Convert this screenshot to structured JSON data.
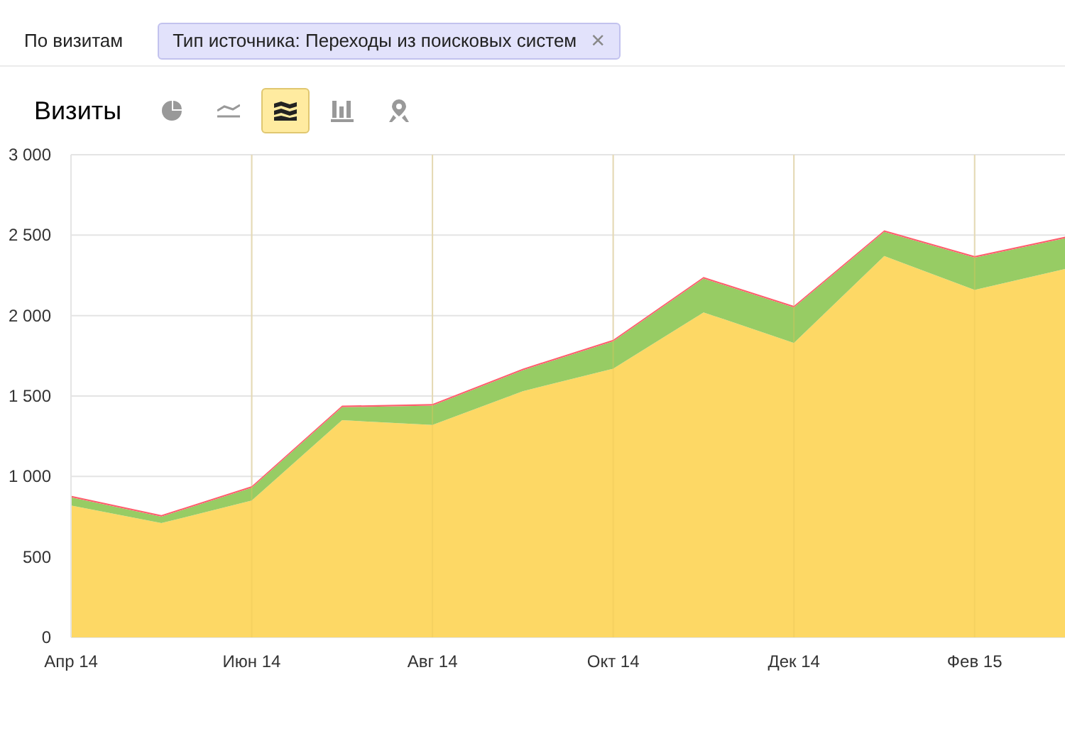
{
  "filter_bar": {
    "label": "По визитам",
    "chip": {
      "text": "Тип источника: Переходы из поисковых систем",
      "close": "×"
    }
  },
  "chart_header": {
    "title": "Визиты",
    "chart_types": [
      {
        "kind": "pie",
        "selected": false
      },
      {
        "kind": "line",
        "selected": false
      },
      {
        "kind": "area",
        "selected": true
      },
      {
        "kind": "bars",
        "selected": false
      },
      {
        "kind": "map",
        "selected": false
      }
    ]
  },
  "chart_data": {
    "type": "area",
    "stacked": true,
    "categories": [
      "Апр 14",
      null,
      "Июн 14",
      null,
      "Авг 14",
      null,
      "Окт 14",
      null,
      "Дек 14",
      null,
      "Фев 15",
      null
    ],
    "series": [
      {
        "color": "#fdd865",
        "values": [
          820,
          710,
          850,
          1350,
          1320,
          1530,
          1670,
          2020,
          1830,
          2370,
          2160,
          2290
        ]
      },
      {
        "color": "#97cc64",
        "values": [
          50,
          40,
          80,
          80,
          120,
          130,
          170,
          210,
          220,
          150,
          200,
          190
        ]
      },
      {
        "color": "#ff5f6d",
        "values": [
          10,
          10,
          10,
          10,
          10,
          10,
          10,
          10,
          10,
          10,
          10,
          10
        ]
      }
    ],
    "ylim": [
      0,
      3000
    ],
    "grid": true,
    "yticks": [
      {
        "value": 0,
        "label": "0"
      },
      {
        "value": 500,
        "label": "500"
      },
      {
        "value": 1000,
        "label": "1 000"
      },
      {
        "value": 1500,
        "label": "1 500"
      },
      {
        "value": 2000,
        "label": "2 000"
      },
      {
        "value": 2500,
        "label": "2 500"
      },
      {
        "value": 3000,
        "label": "3 000"
      }
    ]
  }
}
